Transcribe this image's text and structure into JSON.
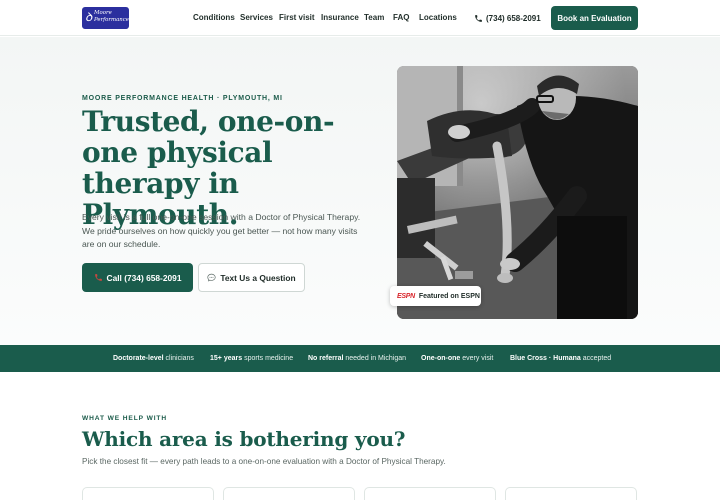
{
  "brand": {
    "logo_line1": "Moore",
    "logo_line2": "Performance Health"
  },
  "nav": {
    "items": [
      "Conditions",
      "Services",
      "First visit",
      "Insurance",
      "Team",
      "FAQ",
      "Locations"
    ]
  },
  "header": {
    "phone": "(734) 658-2091",
    "book_label": "Book an Evaluation"
  },
  "hero": {
    "eyebrow": "MOORE PERFORMANCE HEALTH · PLYMOUTH, MI",
    "title": "Trusted, one-on-one physical therapy in Plymouth.",
    "description": "Every visit is a full one-on-one session with a Doctor of Physical Therapy. We pride ourselves on how quickly you get better — not how many visits are on our schedule.",
    "call_label": "Call (734) 658-2091",
    "text_label": "Text Us a Question",
    "badge_logo": "ESPN",
    "badge_label": "Featured on ESPN"
  },
  "credentials": [
    {
      "strong": "Doctorate-level",
      "rest": " clinicians"
    },
    {
      "strong": "15+ years",
      "rest": " sports medicine"
    },
    {
      "strong": "No referral",
      "rest": " needed in Michigan"
    },
    {
      "strong": "One-on-one",
      "rest": " every visit"
    },
    {
      "strong": "Blue Cross · Humana",
      "rest": " accepted"
    }
  ],
  "areas": {
    "eyebrow": "WHAT WE HELP WITH",
    "title": "Which area is bothering you?",
    "subtitle": "Pick the closest fit — every path leads to a one-on-one evaluation with a Doctor of Physical Therapy.",
    "cards": [
      "",
      "",
      "",
      ""
    ]
  },
  "colors": {
    "brand_green": "#1a5c4c",
    "logo_blue": "#2b2f9e",
    "espn_red": "#d8262c"
  }
}
